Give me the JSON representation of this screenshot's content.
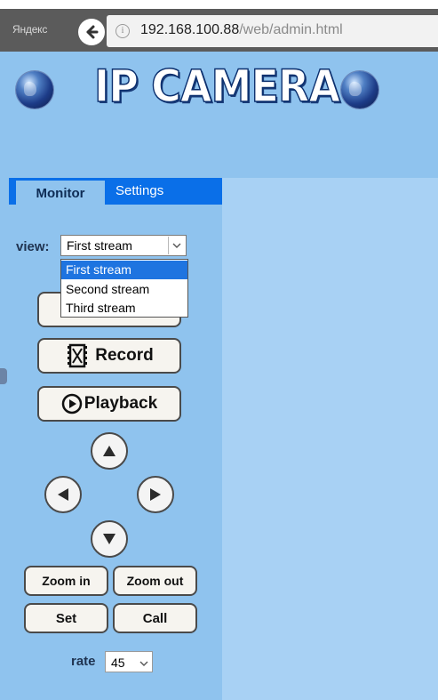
{
  "browser": {
    "brand": "Яндекс",
    "url_host": "192.168.100.88",
    "url_path": "/web/admin.html"
  },
  "header": {
    "logo_text": "IP CAMERA"
  },
  "tabs": [
    {
      "label": "Monitor",
      "active": true
    },
    {
      "label": "Settings",
      "active": false
    }
  ],
  "view": {
    "label": "view:",
    "selected": "First stream",
    "options": [
      "First stream",
      "Second stream",
      "Third stream"
    ]
  },
  "buttons": {
    "snapshot": "",
    "record": "Record",
    "playback": "Playback",
    "zoom_in": "Zoom in",
    "zoom_out": "Zoom out",
    "set": "Set",
    "call": "Call"
  },
  "rate": {
    "label": "rate",
    "value": "45"
  },
  "colors": {
    "tab_bar": "#0a6fe8",
    "panel_bg": "#8fc3ee",
    "content_bg": "#a8d1f4",
    "selection": "#1e74e0"
  }
}
